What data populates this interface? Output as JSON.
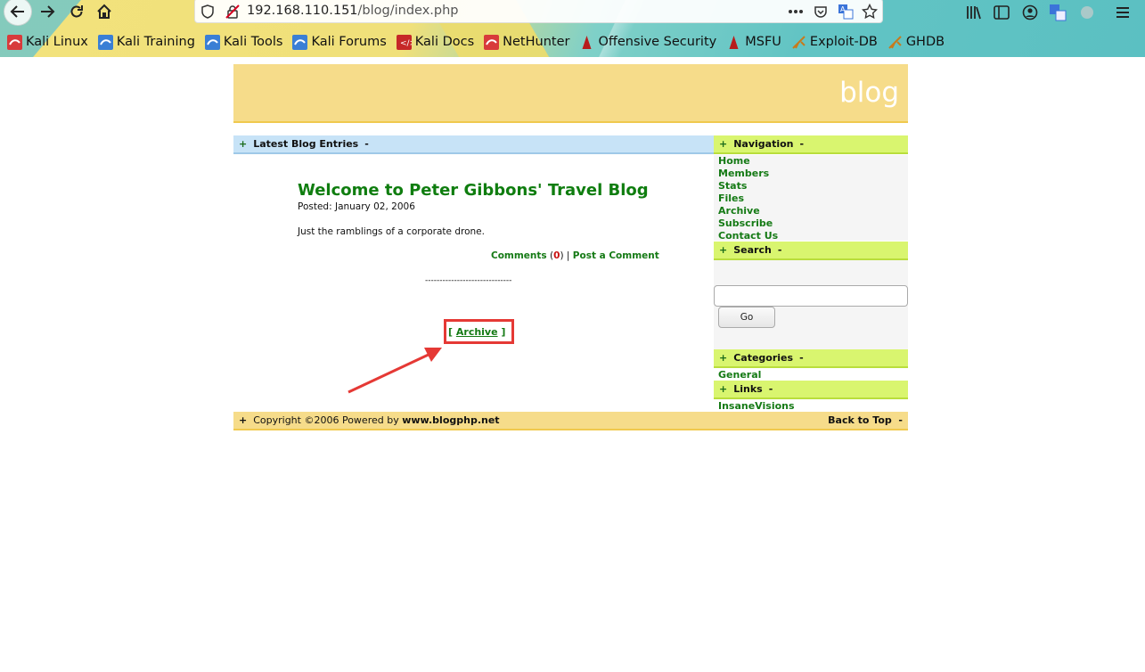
{
  "browser": {
    "url_host": "192.168.110.151",
    "url_path": "/blog/index.php",
    "bookmarks": [
      {
        "label": "Kali Linux",
        "icon": "kali-icon"
      },
      {
        "label": "Kali Training",
        "icon": "kali-training-icon"
      },
      {
        "label": "Kali Tools",
        "icon": "kali-tools-icon"
      },
      {
        "label": "Kali Forums",
        "icon": "kali-forums-icon"
      },
      {
        "label": "Kali Docs",
        "icon": "kali-docs-icon"
      },
      {
        "label": "NetHunter",
        "icon": "nethunter-icon"
      },
      {
        "label": "Offensive Security",
        "icon": "offsec-icon"
      },
      {
        "label": "MSFU",
        "icon": "msfu-icon"
      },
      {
        "label": "Exploit-DB",
        "icon": "exploitdb-icon"
      },
      {
        "label": "GHDB",
        "icon": "ghdb-icon"
      }
    ]
  },
  "site": {
    "header_title": "blog",
    "main_bar": {
      "plus": "+",
      "label": "Latest Blog Entries",
      "minus": "-"
    },
    "post": {
      "title": "Welcome to Peter Gibbons' Travel Blog",
      "posted": "Posted: January 02, 2006",
      "body": "Just the ramblings of a corporate drone.",
      "comments_label": "Comments",
      "comments_count": "0",
      "post_comment_label": "Post a Comment",
      "separator": "------------------------------"
    },
    "archive": {
      "open": "[",
      "label": "Archive",
      "close": "]"
    },
    "sidebar": {
      "navigation": {
        "label": "Navigation",
        "items": [
          "Home",
          "Members",
          "Stats",
          "Files",
          "Archive",
          "Subscribe",
          "Contact Us"
        ]
      },
      "search": {
        "label": "Search",
        "input_value": "",
        "button": "Go"
      },
      "categories": {
        "label": "Categories",
        "items": [
          "General"
        ]
      },
      "links": {
        "label": "Links",
        "items": [
          "InsaneVisions"
        ]
      }
    },
    "footer": {
      "copyright": "Copyright ©2006 Powered by",
      "powered_by": "www.blogphp.net",
      "back_to_top": "Back to Top"
    }
  },
  "colors": {
    "header": "#f6dc8a",
    "accent_green": "#157a15",
    "annotation_red": "#e53935"
  }
}
